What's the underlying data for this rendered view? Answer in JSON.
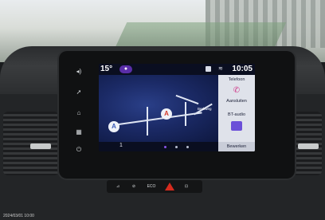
{
  "status_bar": {
    "temperature": "15°",
    "clock": "10:05"
  },
  "map": {
    "label": "Berkweg",
    "pin_a": "A",
    "pin_b": "A"
  },
  "bottom_bar": {
    "page_number": "1"
  },
  "side_panel": {
    "phone_title": "Telefoon",
    "phone_action": "Aansluiten",
    "audio_title": "BT-audio",
    "edit_label": "Bewerken"
  },
  "hardware_buttons": {
    "eco_label": "ECO"
  },
  "watermark": "2024/03/01  10:00",
  "colors": {
    "screen_background": "#0c1230",
    "panel_background": "#dfe2ea",
    "accent_purple": "#8a55e8",
    "hazard_red": "#d52b1e"
  },
  "icons": [
    "volume-icon",
    "navigation-icon",
    "home-icon",
    "apps-icon",
    "power-icon",
    "phone-icon",
    "bluetooth-audio-icon",
    "hazard-icon"
  ]
}
